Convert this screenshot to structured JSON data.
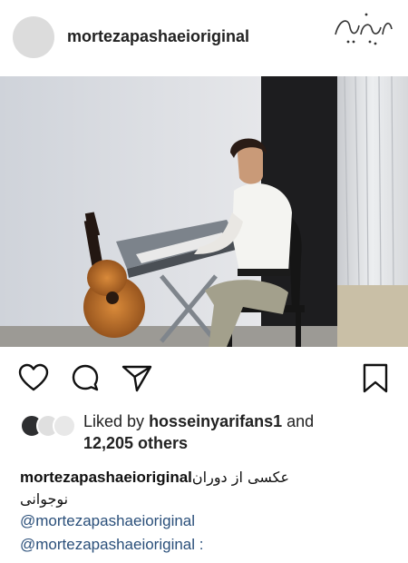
{
  "post": {
    "username": "mortezapashaeioriginal"
  },
  "watermark": {
    "text": "بیتوته"
  },
  "actions": {
    "like_icon": "heart-icon",
    "comment_icon": "comment-icon",
    "share_icon": "send-icon",
    "save_icon": "bookmark-icon"
  },
  "likes": {
    "prefix": "Liked by",
    "user": "hosseinyarifans1",
    "conj": "and",
    "count_text": "12,205 others"
  },
  "caption": {
    "username": "mortezapashaeioriginal",
    "text_line1": "عکسی از دوران",
    "text_line2": "نوجوانی",
    "mention1": "@mortezapashaeioriginal",
    "mention2": "@mortezapashaeioriginal :"
  },
  "colors": {
    "mention": "#2a4f7a",
    "text": "#111111"
  }
}
